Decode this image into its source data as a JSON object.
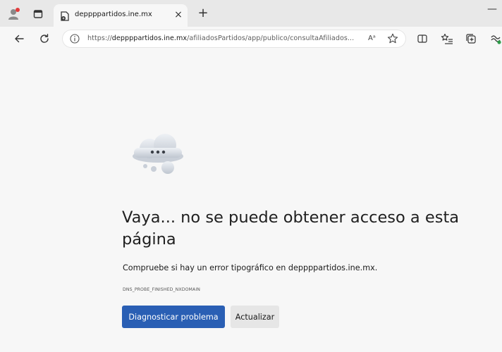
{
  "browser": {
    "tab": {
      "title": "deppppartidos.ine.mx",
      "close_symbol": "×"
    },
    "new_tab_symbol": "+",
    "minimize_symbol": "—",
    "address_bar": {
      "scheme": "https://",
      "host": "deppppartidos.ine.mx",
      "path": "/afiliadosPartidos/app/publico/consultaAfiliados...",
      "read_aloud_label": "Aᵃ"
    }
  },
  "error_page": {
    "heading": "Vaya... no se puede obtener acceso a esta página",
    "suggestion": "Compruebe si hay un error tipográfico en deppppartidos.ine.mx.",
    "error_code": "DNS_PROBE_FINISHED_NXDOMAIN",
    "primary_button": "Diagnosticar problema",
    "secondary_button": "Actualizar"
  },
  "colors": {
    "primary_button": "#2a5fb4",
    "profile_badge": "#e23b3b",
    "background": "#f7f7f7",
    "titlebar": "#e8e8e8"
  },
  "icons": {
    "profile": "profile-avatar-icon",
    "tab_actions": "tab-actions-icon",
    "favicon": "site-favicon-icon",
    "back": "back-arrow-icon",
    "refresh": "refresh-icon",
    "info": "info-icon",
    "favorite": "star-icon",
    "split_screen": "split-screen-icon",
    "favorites_list": "favorites-list-icon",
    "collections": "collections-icon",
    "extensions": "extensions-icon",
    "error_illustration": "cloud-error-icon"
  }
}
